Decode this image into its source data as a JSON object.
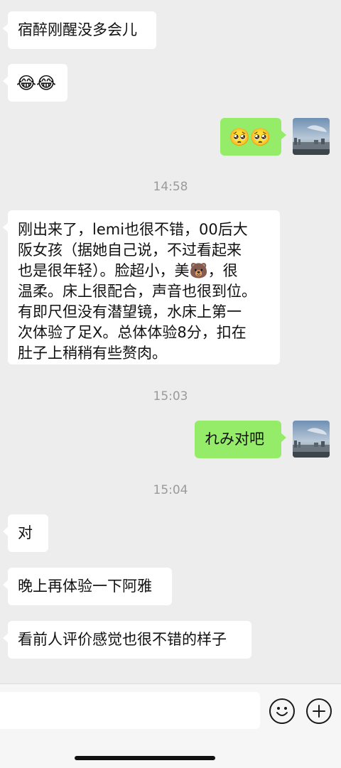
{
  "messages": {
    "m1": "宿醉刚醒没多会儿",
    "m2_emoji": "😂😂",
    "m3_emoji": "🥺🥺",
    "ts1": "14:58",
    "m4_lines": [
      "刚出来了，lemi也很不错，00后大",
      "阪女孩（据她自己说，不过看起来",
      "也是很年轻）。脸超小，美🐻，很",
      "温柔。床上很配合，声音也很到位。",
      "有即尺但没有潜望镜，水床上第一",
      "次体验了足X。总体体验8分，扣在",
      "肚子上稍稍有些赘肉。"
    ],
    "ts2": "15:03",
    "m5": "れみ对吧",
    "ts3": "15:04",
    "m6": "对",
    "m7": "晚上再体验一下阿雅",
    "m8": "看前人评价感觉也很不错的样子"
  },
  "colors": {
    "background": "#ededed",
    "bubble_in": "#ffffff",
    "bubble_out": "#95ec69",
    "timestamp": "#9a9a9a"
  },
  "icons": {
    "avatar": "city-skyline-photo-avatar",
    "emoji_button": "smiley-face-icon",
    "more_button": "plus-circle-icon"
  }
}
